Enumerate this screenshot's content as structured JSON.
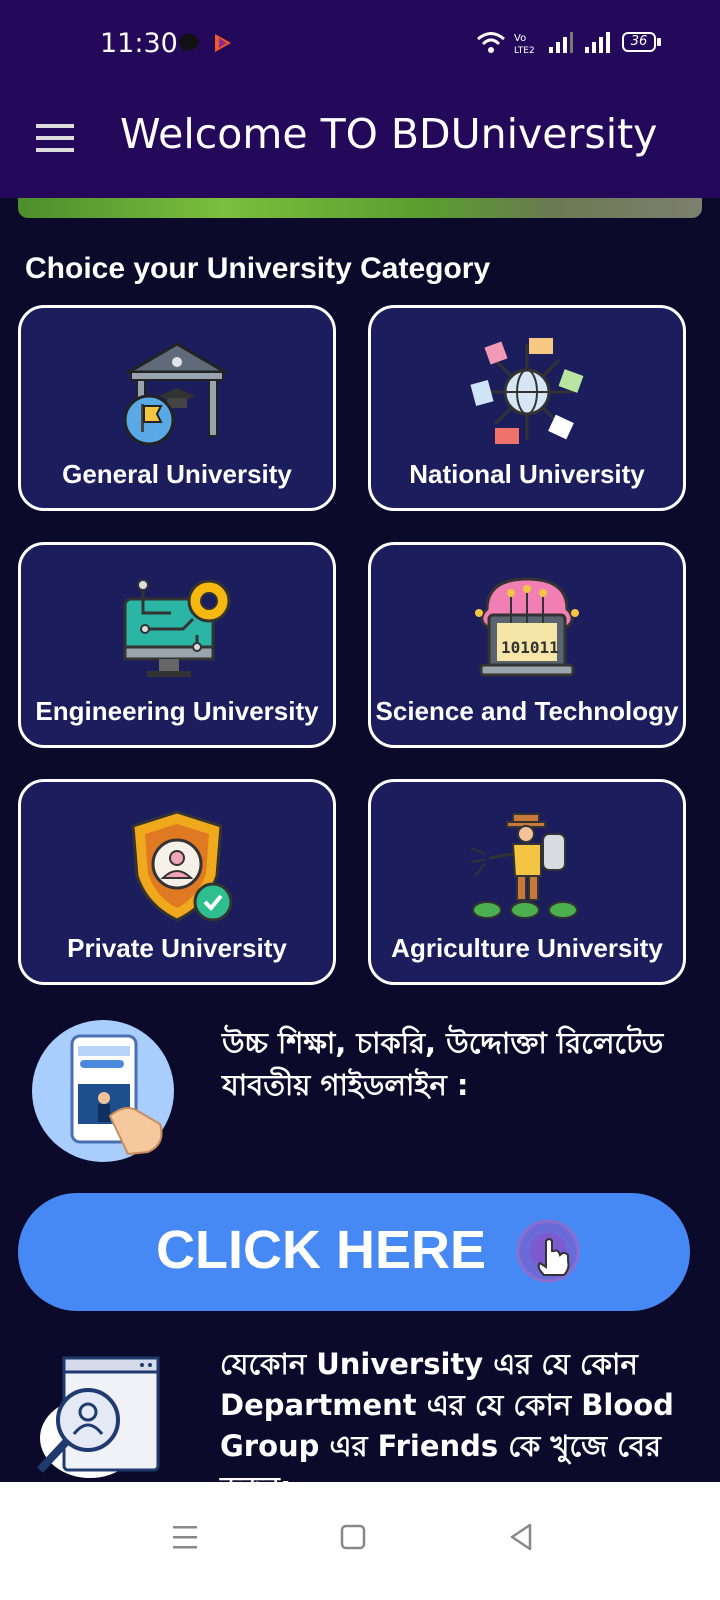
{
  "status_bar": {
    "time": "11:30",
    "battery": "36"
  },
  "app_bar": {
    "title": "Welcome TO BDUniversity"
  },
  "section": {
    "title": "Choice your University Category"
  },
  "categories": [
    {
      "label": "General University",
      "icon": "university-building-icon"
    },
    {
      "label": "National University",
      "icon": "globe-flags-icon"
    },
    {
      "label": "Engineering University",
      "icon": "computer-gear-icon"
    },
    {
      "label": "Science and Technology",
      "icon": "brain-laptop-icon"
    },
    {
      "label": "Private University",
      "icon": "shield-user-icon"
    },
    {
      "label": "Agriculture University",
      "icon": "farmer-spraying-icon"
    }
  ],
  "guide": {
    "text": "উচ্চ শিক্ষা, চাকরি, উদ্দোক্তা রিলেটেড যাবতীয় গাইডলাইন :"
  },
  "cta": {
    "label": "CLICK HERE"
  },
  "friends": {
    "text": "যেকোন University এর যে কোন Department এর যে কোন Blood Group এর Friends কে খুজে বের করুন:"
  },
  "colors": {
    "app_bar": "#24095a",
    "background": "#0b0a2a",
    "card": "#1b1d5c",
    "cta": "#4689f4"
  }
}
